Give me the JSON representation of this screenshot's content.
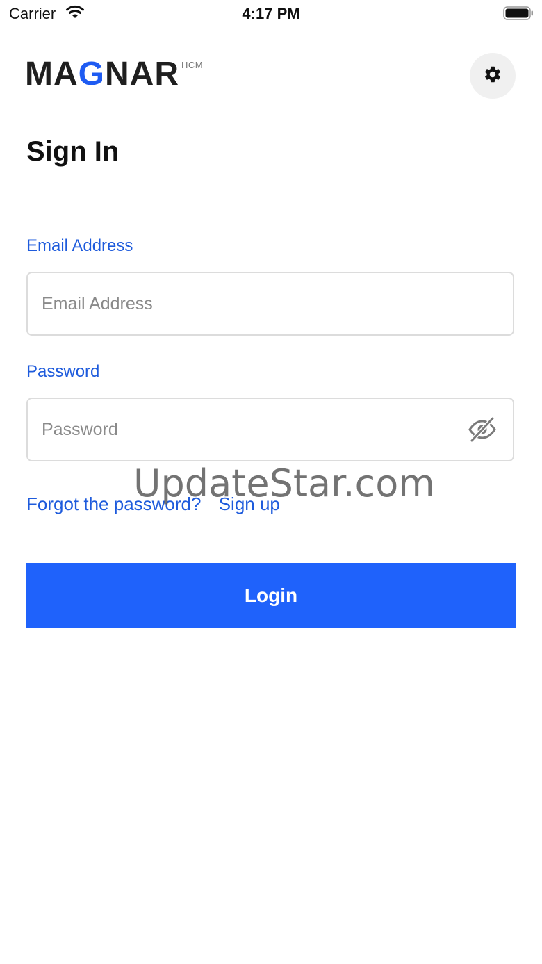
{
  "status_bar": {
    "carrier": "Carrier",
    "time": "4:17 PM",
    "icons": [
      "wifi-icon",
      "battery-icon"
    ]
  },
  "header": {
    "logo": {
      "before_g": "MA",
      "g": "G",
      "after_g": "NAR",
      "superscript": "HCM"
    },
    "settings_icon": "gear-icon"
  },
  "page": {
    "title": "Sign In"
  },
  "form": {
    "email": {
      "label": "Email Address",
      "placeholder": "Email Address",
      "value": ""
    },
    "password": {
      "label": "Password",
      "placeholder": "Password",
      "value": "",
      "toggle_icon": "eye-slash-icon"
    }
  },
  "links": {
    "forgot_password": "Forgot the password?",
    "sign_up": "Sign up"
  },
  "actions": {
    "login_label": "Login"
  },
  "watermark": "UpdateStar.com",
  "colors": {
    "accent": "#1e5bdc",
    "button": "#1f62fb",
    "logo_g": "#1e5bf2",
    "input_border": "#dcdcdc"
  }
}
